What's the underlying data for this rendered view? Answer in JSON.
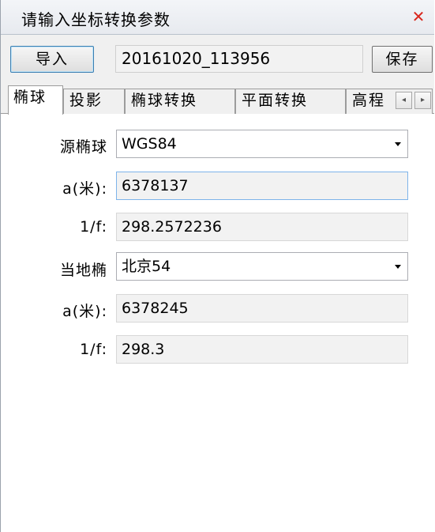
{
  "window": {
    "title": "请输入坐标转换参数",
    "close_icon": "close-icon"
  },
  "toolbar": {
    "import_label": "导入",
    "filename": "20161020_113956",
    "save_label": "保存"
  },
  "tabs": [
    {
      "label": "椭球",
      "active": true
    },
    {
      "label": "投影",
      "active": false
    },
    {
      "label": "椭球转换",
      "active": false
    },
    {
      "label": "平面转换",
      "active": false
    },
    {
      "label": "高程",
      "active": false
    }
  ],
  "tab_scroll": {
    "left_icon": "arrow-left-icon",
    "right_icon": "arrow-right-icon",
    "left_glyph": "◂",
    "right_glyph": "▸"
  },
  "source": {
    "label": "源椭球",
    "ellipsoid": "WGS84",
    "a_label": "a(米):",
    "a_value": "6378137",
    "f_label": "1/f:",
    "f_value": "298.2572236"
  },
  "local": {
    "label": "当地椭",
    "ellipsoid": "北京54",
    "a_label": "a(米):",
    "a_value": "6378245",
    "f_label": "1/f:",
    "f_value": "298.3"
  },
  "colors": {
    "close": "#d9261c",
    "focus_border": "#7eb4ea"
  }
}
